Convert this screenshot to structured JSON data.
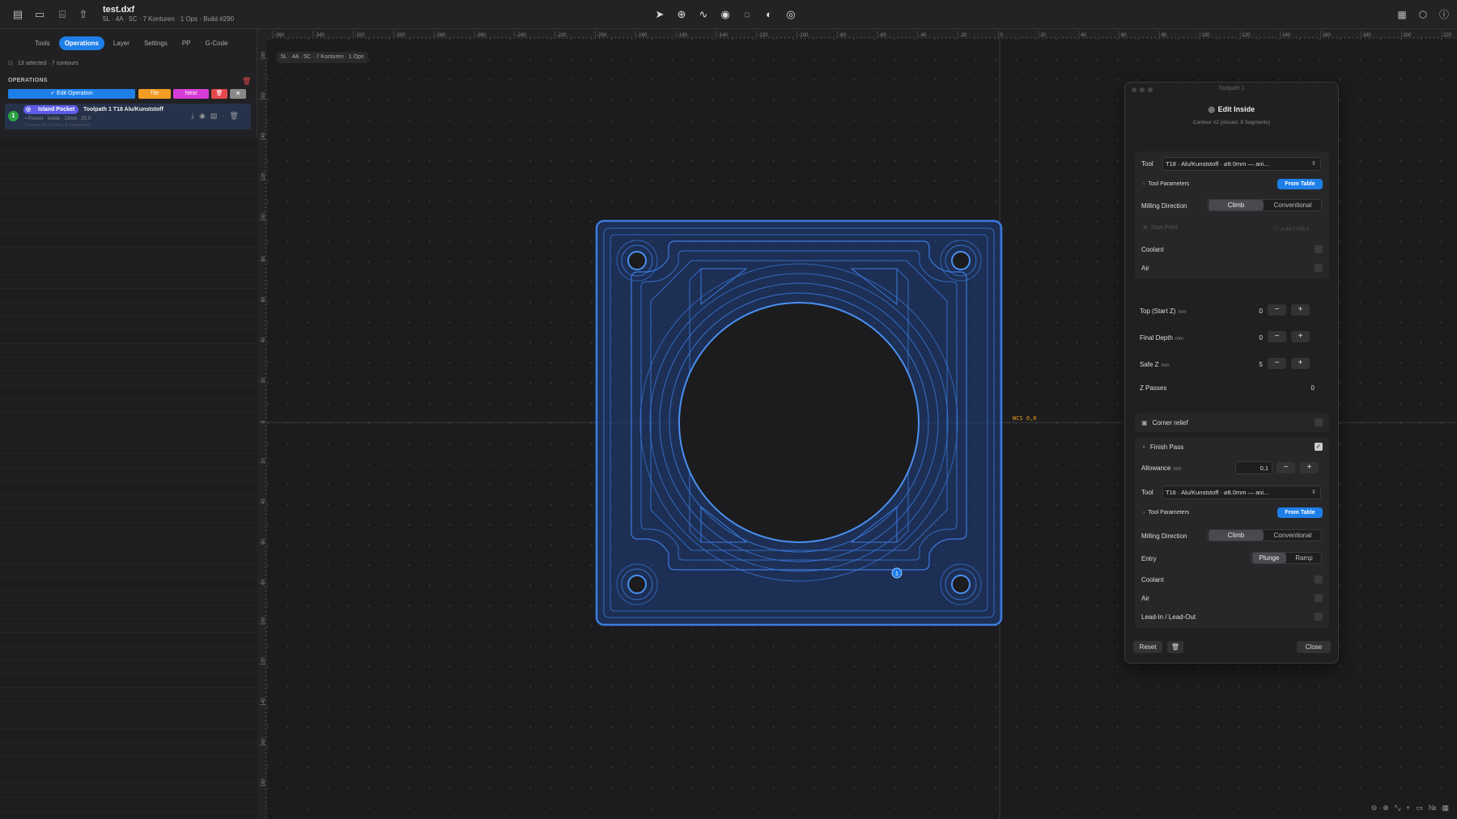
{
  "titlebar": {
    "file_name": "test.dxf",
    "file_info": "5L · 4A · 5C · 7 Konturen · 1 Ops · Build #290"
  },
  "sidebar": {
    "tabs": [
      "Tools",
      "Operations",
      "Layer",
      "Settings",
      "PP",
      "G-Code"
    ],
    "active_tab": "Operations",
    "selection_info": "13 selected · 7 contours",
    "operations_header": "OPERATIONS",
    "toolbar": {
      "edit": "✓ Edit Operation",
      "tile": "Tile",
      "nest": "Nest",
      "delete": "🗑",
      "close": "✕"
    },
    "operation": {
      "number": "1",
      "type": "Island Pocket",
      "title": "Toolpath 1  T18  Alu/Kunststoff",
      "details": "• Pocket · inside · Climb · Z0.0",
      "contour": "Contour #2 (closed, 8 Segments)"
    }
  },
  "canvas": {
    "doc_label": "5L · 4A · 5C · 7 Konturen · 1 Ops",
    "wcs_label": "WCS 0,0",
    "ruler_x": [
      "-360",
      "-340",
      "-320",
      "-300",
      "-280",
      "-260",
      "-240",
      "-220",
      "-200",
      "-180",
      "-160",
      "-140",
      "-120",
      "-100",
      "-80",
      "-60",
      "-40",
      "-20",
      "0",
      "20",
      "40",
      "60",
      "80",
      "100",
      "120",
      "140",
      "160",
      "180",
      "200",
      "220"
    ],
    "ruler_y": [
      "180",
      "160",
      "140",
      "120",
      "100",
      "80",
      "60",
      "40",
      "20",
      "0",
      "20",
      "40",
      "60",
      "80",
      "100",
      "120",
      "140",
      "160",
      "180"
    ],
    "marker_label": "1"
  },
  "panel": {
    "window_title": "Toolpath 1",
    "heading": "Edit Inside",
    "subheading": "Contour #2 (closed, 8 Segments)",
    "tool_label": "Tool",
    "tool_value": "T18 · Alu/Kunststoff · ⌀9.0mm — ani...",
    "tool_params": "Tool Parameters",
    "from_table": "From Table",
    "milling_direction": "Milling Direction",
    "climb": "Climb",
    "conventional": "Conventional",
    "start_point": "Start Point",
    "start_point_value": "X-94.0 Y95.5",
    "coolant": "Coolant",
    "air": "Air",
    "top_start_z": "Top (Start Z)",
    "top_start_z_value": "0",
    "final_depth": "Final Depth",
    "final_depth_value": "0",
    "safe_z": "Safe Z",
    "safe_z_value": "5",
    "unit_mm": "mm",
    "z_passes": "Z Passes",
    "z_passes_value": "0",
    "corner_relief": "Corner relief",
    "finish_pass": "Finish Pass",
    "allowance": "Allowance",
    "allowance_value": "0,1",
    "finish_tool_value": "T16 · Alu/Kunststoff · ⌀8.0mm — ani...",
    "entry": "Entry",
    "plunge": "Plunge",
    "ramp": "Ramp",
    "lead_in_out": "Lead-In / Lead-Out",
    "reset": "Reset",
    "close": "Close",
    "minus": "−",
    "plus": "+"
  },
  "colors": {
    "accent": "#1f7fe8",
    "toolpath": "#3b7be0",
    "part_fill": "#1f3f82"
  }
}
